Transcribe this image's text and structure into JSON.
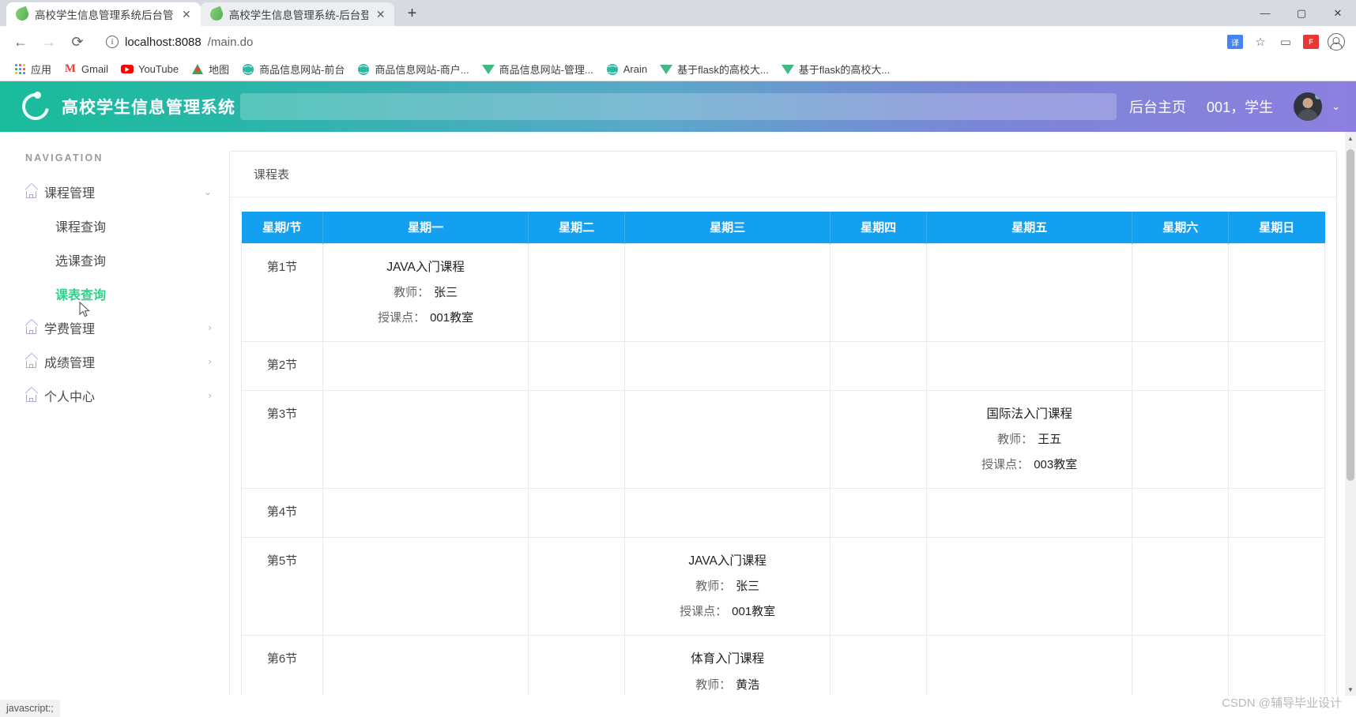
{
  "browser": {
    "tabs": [
      {
        "title": "高校学生信息管理系统后台管理",
        "close": "✕",
        "active": true
      },
      {
        "title": "高校学生信息管理系统-后台登录",
        "close": "✕",
        "active": false
      }
    ],
    "newtab_label": "+",
    "window_controls": {
      "minimize": "—",
      "maximize": "▢",
      "close": "✕"
    },
    "nav": {
      "back": "←",
      "forward": "→",
      "reload": "⟳",
      "info": "i"
    },
    "url": {
      "host": "localhost:8088",
      "path": "/main.do"
    },
    "toolbar_icons": {
      "translate": "译",
      "bookmark_star": "☆",
      "cast": "▭",
      "extension": "F",
      "profile": "profile-icon"
    },
    "bookmarks": [
      {
        "label": "应用",
        "icon": "apps-grid-icon"
      },
      {
        "label": "Gmail",
        "icon": "gmail-icon"
      },
      {
        "label": "YouTube",
        "icon": "youtube-icon"
      },
      {
        "label": "地图",
        "icon": "maps-icon"
      },
      {
        "label": "商品信息网站-前台",
        "icon": "globe-icon"
      },
      {
        "label": "商品信息网站-商户...",
        "icon": "globe-icon"
      },
      {
        "label": "商品信息网站-管理...",
        "icon": "vue-icon"
      },
      {
        "label": "Arain",
        "icon": "globe-icon"
      },
      {
        "label": "基于flask的高校大...",
        "icon": "vue-icon"
      },
      {
        "label": "基于flask的高校大...",
        "icon": "vue-icon"
      }
    ],
    "status_text": "javascript:;"
  },
  "app_header": {
    "logo_title": "高校学生信息管理系统",
    "home_link": "后台主页",
    "user_label": "001，学生",
    "caret": "⌄"
  },
  "sidebar": {
    "nav_title": "NAVIGATION",
    "groups": [
      {
        "label": "课程管理",
        "arrow": "⌄",
        "expanded": true,
        "children": [
          {
            "label": "课程查询",
            "active": false
          },
          {
            "label": "选课查询",
            "active": false
          },
          {
            "label": "课表查询",
            "active": true
          }
        ]
      },
      {
        "label": "学费管理",
        "arrow": "›",
        "expanded": false,
        "children": []
      },
      {
        "label": "成绩管理",
        "arrow": "›",
        "expanded": false,
        "children": []
      },
      {
        "label": "个人中心",
        "arrow": "›",
        "expanded": false,
        "children": []
      }
    ]
  },
  "panel": {
    "title": "课程表"
  },
  "schedule": {
    "headers": [
      "星期/节",
      "星期一",
      "星期二",
      "星期三",
      "星期四",
      "星期五",
      "星期六",
      "星期日"
    ],
    "teacher_label": "教师：",
    "room_label": "授课点：",
    "rows": [
      {
        "section": "第1节",
        "cells": [
          {
            "course": "JAVA入门课程",
            "teacher": "张三",
            "room": "001教室"
          },
          {},
          {},
          {},
          {},
          {},
          {}
        ]
      },
      {
        "section": "第2节",
        "cells": [
          {},
          {},
          {},
          {},
          {},
          {},
          {}
        ]
      },
      {
        "section": "第3节",
        "cells": [
          {},
          {},
          {},
          {},
          {
            "course": "国际法入门课程",
            "teacher": "王五",
            "room": "003教室"
          },
          {},
          {}
        ]
      },
      {
        "section": "第4节",
        "cells": [
          {},
          {},
          {},
          {},
          {},
          {},
          {}
        ]
      },
      {
        "section": "第5节",
        "cells": [
          {},
          {},
          {
            "course": "JAVA入门课程",
            "teacher": "张三",
            "room": "001教室"
          },
          {},
          {},
          {},
          {}
        ]
      },
      {
        "section": "第6节",
        "cells": [
          {},
          {},
          {
            "course": "体育入门课程",
            "teacher": "黄浩",
            "room": ""
          },
          {},
          {},
          {},
          {}
        ]
      }
    ]
  },
  "watermark": "CSDN @辅导毕业设计",
  "colors": {
    "header_gradient_start": "#1abc9c",
    "header_gradient_end": "#8d7fe0",
    "table_header_blue": "#14a0f0",
    "active_nav_green": "#2fd18a"
  }
}
